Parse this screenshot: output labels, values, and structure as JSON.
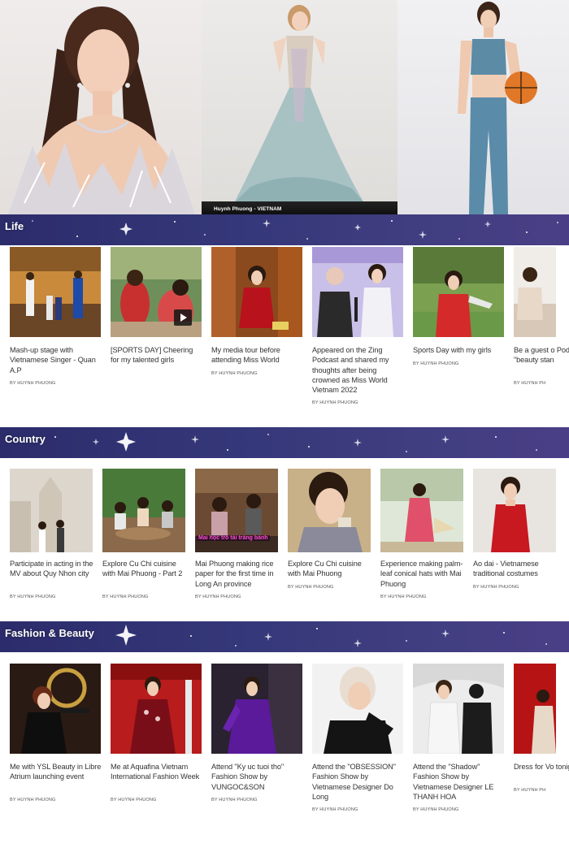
{
  "hero": {
    "caption": "Huynh Phuong - VIETNAM"
  },
  "sections": [
    {
      "title": "Life",
      "items": [
        {
          "title": "Mash-up stage with Vietnamese Singer - Quan A.P",
          "author": "BY HUYNH PHUONG"
        },
        {
          "title": "[SPORTS DAY] Cheering for my talented girls",
          "author": ""
        },
        {
          "title": "My media tour before attending Miss World",
          "author": "BY HUYNH PHUONG"
        },
        {
          "title": "Appeared on the Zing Podcast and shared my thoughts after being crowned as Miss World Vietnam 2022",
          "author": "BY HUYNH PHUONG"
        },
        {
          "title": "Sports Day with my girls",
          "author": "BY HUYNH PHUONG"
        },
        {
          "title": "Be a guest o Podcast - tal \"beauty stan",
          "author": "BY HUYNH PH"
        }
      ]
    },
    {
      "title": "Country",
      "items": [
        {
          "title": "Participate in acting in the MV about Quy Nhon city",
          "author": "BY HUYNH PHUONG"
        },
        {
          "title": "Explore Cu Chi cuisine with Mai Phuong - Part 2",
          "author": "BY HUYNH PHUONG"
        },
        {
          "title": "Mai Phuong making rice paper for the first time in Long An province",
          "author": "BY HUYNH PHUONG",
          "thumb_caption": "Mai học trổ tài tráng bánh"
        },
        {
          "title": "Explore Cu Chi cuisine with Mai Phuong",
          "author": "BY HUYNH PHUONG"
        },
        {
          "title": "Experience making palm-leaf conical hats with Mai Phuong",
          "author": "BY HUYNH PHUONG"
        },
        {
          "title": "Ao dai - Vietnamese traditional costumes",
          "author": "BY HUYNH PHUONG"
        }
      ]
    },
    {
      "title": "Fashion & Beauty",
      "items": [
        {
          "title": "Me with YSL Beauty in Libre Atrium launching event",
          "author": "BY HUYNH PHUONG"
        },
        {
          "title": "Me at Aquafina Vietnam International Fashion Week",
          "author": "BY HUYNH PHUONG"
        },
        {
          "title": "Attend \"Ky uc tuoi tho\" Fashion Show by VUNGOC&SON",
          "author": "BY HUYNH PHUONG"
        },
        {
          "title": "Attend the \"OBSESSION\" Fashion Show by Vietnamese Designer Do Long",
          "author": "BY HUYNH PHUONG"
        },
        {
          "title": "Attend the \"Shadow\" Fashion Show by Vietnamese Designer LE THANH HOA",
          "author": "BY HUYNH PHUONG"
        },
        {
          "title": "Dress for Vo tonight ✨",
          "author": "BY HUYNH PH"
        }
      ]
    }
  ],
  "colors": {
    "banner": "#35387a",
    "text": "#333333",
    "author": "#555555"
  }
}
